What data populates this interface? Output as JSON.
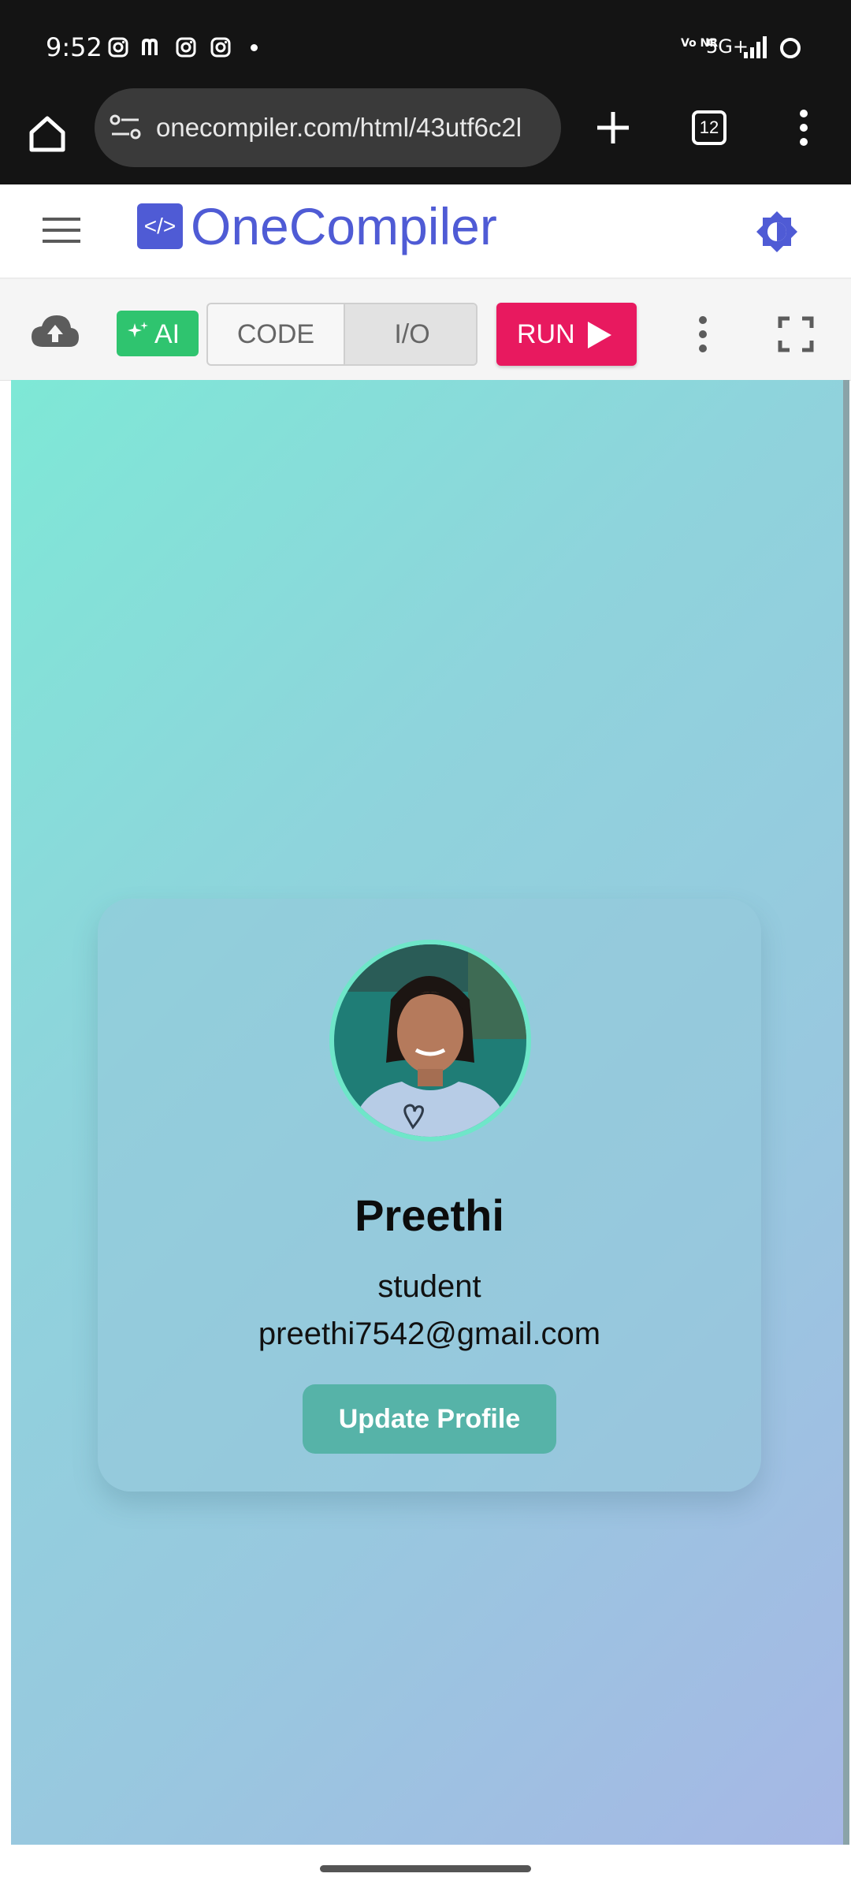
{
  "status_bar": {
    "time": "9:52",
    "notification_icons": [
      "instagram-icon",
      "m-app-icon",
      "instagram-icon",
      "instagram-icon"
    ],
    "vonr_label": "Vo NR",
    "network_label": "5G+"
  },
  "browser": {
    "url": "onecompiler.com/html/43utf6c2l",
    "tab_count": "12"
  },
  "header": {
    "logo_mark": "</>",
    "brand_name": "OneCompiler"
  },
  "toolbar": {
    "ai_label": "AI",
    "code_tab_label": "CODE",
    "io_tab_label": "I/O",
    "run_label": "RUN"
  },
  "profile": {
    "name": "Preethi",
    "role": "student",
    "email": "preethi7542@gmail.com",
    "update_label": "Update Profile"
  },
  "colors": {
    "brand": "#4f5bd5",
    "run": "#e8195f",
    "ai": "#2fc46f",
    "accent": "#56b3a8",
    "avatar_ring": "#6fe6c9"
  }
}
